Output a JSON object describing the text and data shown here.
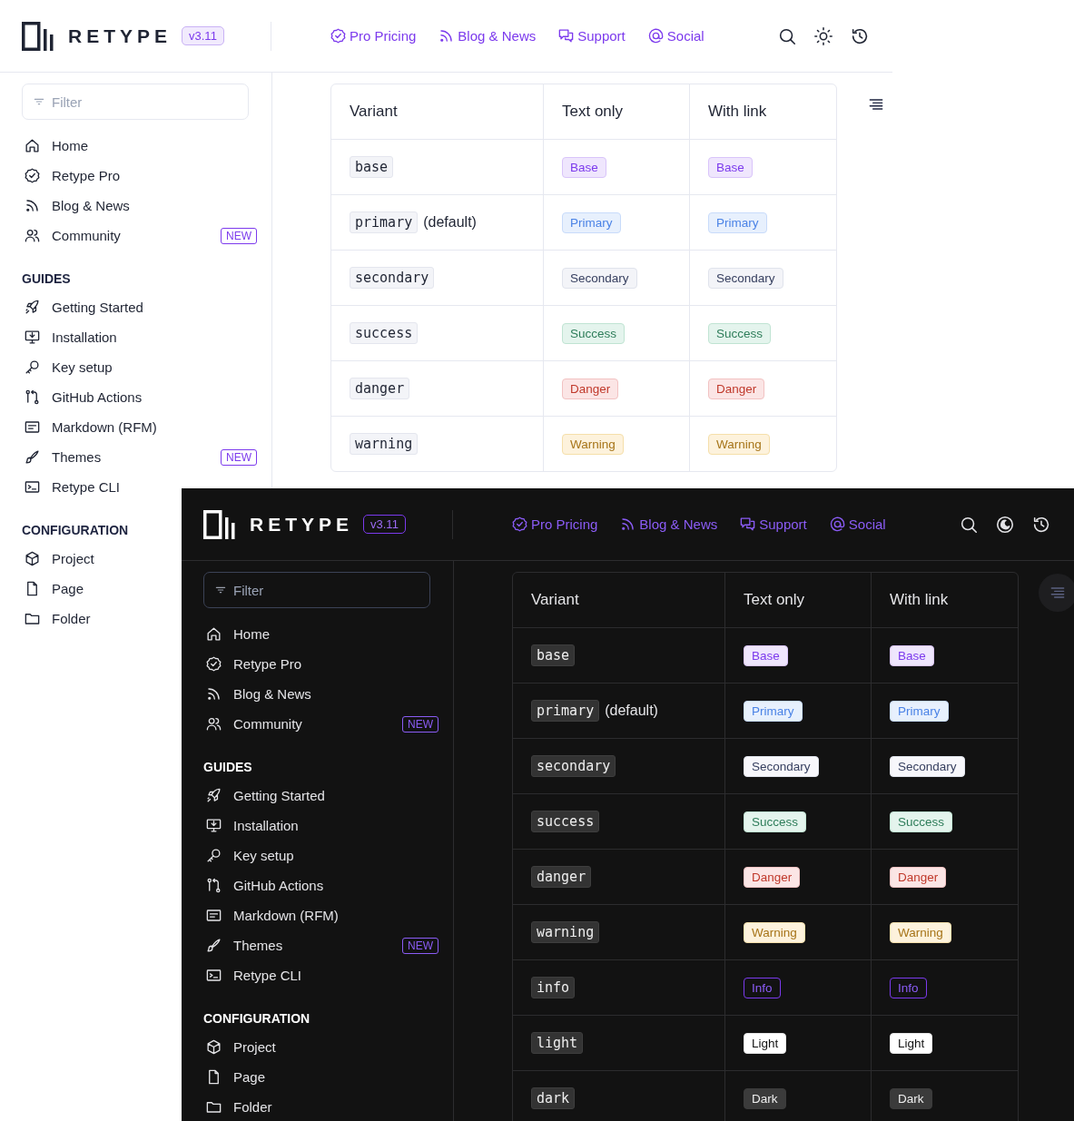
{
  "views": [
    {
      "kind": "light",
      "header": {
        "brand": "RETYPE",
        "version": "v3.11",
        "nav": [
          {
            "label": "Pro Pricing"
          },
          {
            "label": "Blog & News"
          },
          {
            "label": "Support"
          },
          {
            "label": "Social"
          }
        ]
      },
      "sidebar": {
        "filter_placeholder": "Filter",
        "sections": [
          {
            "items": [
              {
                "label": "Home"
              },
              {
                "label": "Retype Pro"
              },
              {
                "label": "Blog & News"
              },
              {
                "label": "Community",
                "badge": "NEW"
              }
            ]
          },
          {
            "title": "GUIDES",
            "items": [
              {
                "label": "Getting Started"
              },
              {
                "label": "Installation"
              },
              {
                "label": "Key setup"
              },
              {
                "label": "GitHub Actions"
              },
              {
                "label": "Markdown (RFM)"
              },
              {
                "label": "Themes",
                "badge": "NEW"
              },
              {
                "label": "Retype CLI"
              }
            ]
          },
          {
            "title": "CONFIGURATION",
            "items": [
              {
                "label": "Project"
              },
              {
                "label": "Page"
              },
              {
                "label": "Folder"
              }
            ]
          }
        ]
      },
      "table": {
        "columns": [
          "Variant",
          "Text only",
          "With link"
        ],
        "rows": [
          {
            "kind": "base",
            "code": "base",
            "text_badge": "Base",
            "link_badge": "Base"
          },
          {
            "kind": "primary",
            "code": "primary",
            "note": "(default)",
            "text_badge": "Primary",
            "link_badge": "Primary"
          },
          {
            "kind": "secondary",
            "code": "secondary",
            "text_badge": "Secondary",
            "link_badge": "Secondary"
          },
          {
            "kind": "success",
            "code": "success",
            "text_badge": "Success",
            "link_badge": "Success"
          },
          {
            "kind": "danger",
            "code": "danger",
            "text_badge": "Danger",
            "link_badge": "Danger"
          },
          {
            "kind": "warning",
            "code": "warning",
            "text_badge": "Warning",
            "link_badge": "Warning"
          }
        ]
      }
    },
    {
      "kind": "dark",
      "header": {
        "brand": "RETYPE",
        "version": "v3.11",
        "nav": [
          {
            "label": "Pro Pricing"
          },
          {
            "label": "Blog & News"
          },
          {
            "label": "Support"
          },
          {
            "label": "Social"
          }
        ]
      },
      "sidebar": {
        "filter_placeholder": "Filter",
        "sections": [
          {
            "items": [
              {
                "label": "Home"
              },
              {
                "label": "Retype Pro"
              },
              {
                "label": "Blog & News"
              },
              {
                "label": "Community",
                "badge": "NEW"
              }
            ]
          },
          {
            "title": "GUIDES",
            "items": [
              {
                "label": "Getting Started"
              },
              {
                "label": "Installation"
              },
              {
                "label": "Key setup"
              },
              {
                "label": "GitHub Actions"
              },
              {
                "label": "Markdown (RFM)"
              },
              {
                "label": "Themes",
                "badge": "NEW"
              },
              {
                "label": "Retype CLI"
              }
            ]
          },
          {
            "title": "CONFIGURATION",
            "items": [
              {
                "label": "Project"
              },
              {
                "label": "Page"
              },
              {
                "label": "Folder"
              }
            ]
          }
        ]
      },
      "table": {
        "columns": [
          "Variant",
          "Text only",
          "With link"
        ],
        "rows": [
          {
            "kind": "base",
            "code": "base",
            "text_badge": "Base",
            "link_badge": "Base"
          },
          {
            "kind": "primary",
            "code": "primary",
            "note": "(default)",
            "text_badge": "Primary",
            "link_badge": "Primary"
          },
          {
            "kind": "secondary",
            "code": "secondary",
            "text_badge": "Secondary",
            "link_badge": "Secondary"
          },
          {
            "kind": "success",
            "code": "success",
            "text_badge": "Success",
            "link_badge": "Success"
          },
          {
            "kind": "danger",
            "code": "danger",
            "text_badge": "Danger",
            "link_badge": "Danger"
          },
          {
            "kind": "warning",
            "code": "warning",
            "text_badge": "Warning",
            "link_badge": "Warning"
          },
          {
            "kind": "info",
            "code": "info",
            "text_badge": "Info",
            "link_badge": "Info"
          },
          {
            "kind": "light",
            "code": "light",
            "text_badge": "Light",
            "link_badge": "Light"
          },
          {
            "kind": "dark",
            "code": "dark",
            "text_badge": "Dark",
            "link_badge": "Dark"
          }
        ]
      }
    }
  ]
}
